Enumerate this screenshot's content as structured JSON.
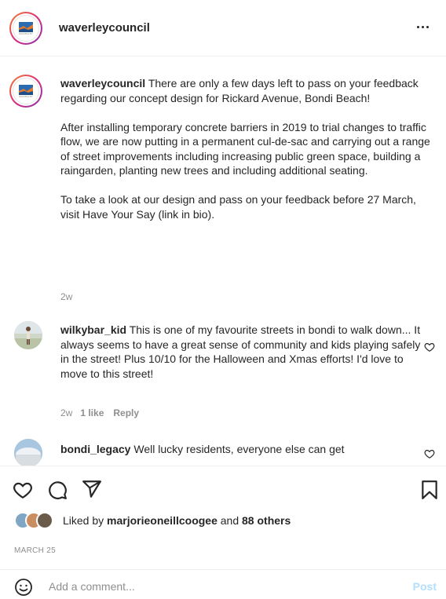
{
  "header": {
    "username": "waverleycouncil",
    "avatar_text": "WAVERLEY"
  },
  "caption": {
    "username": "waverleycouncil",
    "paragraphs": [
      "There are only a few days left to pass on your feedback regarding our concept design for Rickard Avenue, Bondi Beach!",
      "After installing temporary concrete barriers in 2019 to trial changes to traffic flow, we are now putting in a permanent cul-de-sac and carrying out a range of street improvements including increasing public green space, building a raingarden, planting new trees and including additional seating.",
      "To take a look at our design and pass on your feedback before 27 March, visit Have Your Say (link in bio)."
    ],
    "age": "2w"
  },
  "comments": [
    {
      "username": "wilkybar_kid",
      "text": "This is one of my favourite streets in bondi to walk down... It always seems to have a great sense of community and kids playing safely in the street! Plus 10/10 for the Halloween and Xmas efforts! I'd love to move to this street!",
      "age": "2w",
      "likes": "1 like",
      "reply": "Reply"
    },
    {
      "username": "bondi_legacy",
      "text": "Well lucky residents, everyone else can get",
      "age": "",
      "likes": "",
      "reply": ""
    }
  ],
  "actions": {
    "liked_prefix": "Liked by",
    "liked_user": "marjorieoneillcoogee",
    "liked_and": "and",
    "liked_others": "88 others",
    "date": "MARCH 25"
  },
  "add_comment": {
    "placeholder": "Add a comment...",
    "post_label": "Post"
  },
  "colors": {
    "text": "#262626",
    "muted": "#8e8e8e",
    "divider": "#efefef",
    "post_disabled": "#b2dffc"
  }
}
